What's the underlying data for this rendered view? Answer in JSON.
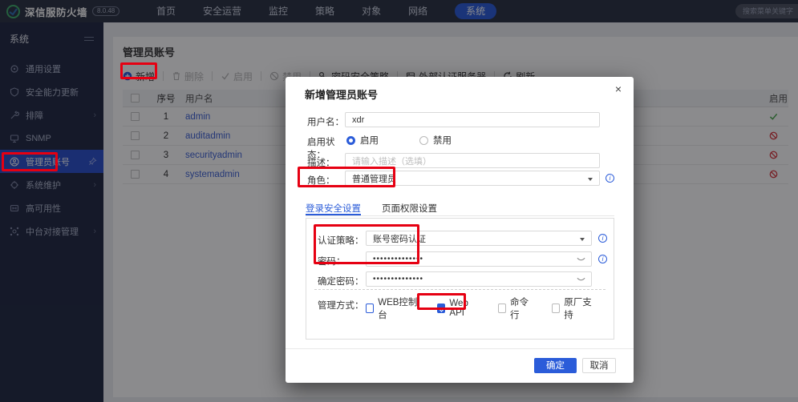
{
  "icons": {
    "chevron": "›",
    "info": "i",
    "hamburger": "",
    "close": "×"
  },
  "colors": {
    "accent": "#2b5cd9",
    "annotation": "#e60012",
    "enabled": "#49a84c",
    "disabled": "#d9363e",
    "topbar": "#2a3142",
    "sidebar": "#212942"
  },
  "topbar": {
    "brand": "深信服防火墙",
    "version": "8.0.48",
    "search_placeholder": "搜索菜单关键字",
    "nav_items": [
      {
        "label": "首页",
        "active": false
      },
      {
        "label": "安全运营",
        "active": false
      },
      {
        "label": "监控",
        "active": false
      },
      {
        "label": "策略",
        "active": false
      },
      {
        "label": "对象",
        "active": false
      },
      {
        "label": "网络",
        "active": false
      },
      {
        "label": "系统",
        "active": true
      }
    ]
  },
  "sidebar": {
    "title": "系统",
    "items": [
      {
        "label": "通用设置",
        "icon": "gear-icon",
        "has_children": false,
        "active": false
      },
      {
        "label": "安全能力更新",
        "icon": "shield-icon",
        "has_children": false,
        "active": false
      },
      {
        "label": "排障",
        "icon": "wrench-icon",
        "has_children": true,
        "active": false
      },
      {
        "label": "SNMP",
        "icon": "monitor-icon",
        "has_children": false,
        "active": false
      },
      {
        "label": "管理员账号",
        "icon": "admin-user-icon",
        "has_children": false,
        "active": true,
        "pinned": true
      },
      {
        "label": "系统维护",
        "icon": "maintenance-gear-icon",
        "has_children": true,
        "active": false
      },
      {
        "label": "高可用性",
        "icon": "ha-icon",
        "has_children": false,
        "active": false
      },
      {
        "label": "中台对接管理",
        "icon": "platform-icon",
        "has_children": true,
        "active": false
      }
    ]
  },
  "content": {
    "page_title": "管理员账号",
    "toolbar": {
      "add": "新增",
      "delete": "删除",
      "enable": "启用",
      "disable": "禁用",
      "password_policy": "密码安全策略",
      "external_auth": "外部认证服务器",
      "refresh": "刷新"
    },
    "table": {
      "headers": {
        "index": "序号",
        "username": "用户名",
        "enabled": "启用"
      },
      "rows": [
        {
          "index": "1",
          "username": "admin",
          "status": "enabled"
        },
        {
          "index": "2",
          "username": "auditadmin",
          "status": "disabled"
        },
        {
          "index": "3",
          "username": "securityadmin",
          "status": "disabled"
        },
        {
          "index": "4",
          "username": "systemadmin",
          "status": "disabled"
        }
      ]
    }
  },
  "modal": {
    "title": "新增管理员账号",
    "close": "×",
    "fields": {
      "username_label": "用户名：",
      "username_value": "xdr",
      "status_label": "启用状态：",
      "status_enable": "启用",
      "status_disable": "禁用",
      "desc_label": "描述：",
      "desc_placeholder": "请输入描述（选填）",
      "role_label": "角色：",
      "role_value": "普通管理员"
    },
    "tabs": {
      "login_security": "登录安全设置",
      "page_permission": "页面权限设置"
    },
    "security": {
      "auth_label": "认证策略：",
      "auth_value": "账号密码认证",
      "password_label": "密码：",
      "password_value": "••••••••••••••",
      "confirm_label": "确定密码：",
      "confirm_value": "••••••••••••••",
      "mgmt_label": "管理方式：",
      "mgmt_options": [
        {
          "label": "WEB控制台",
          "checked": false
        },
        {
          "label": "Web API",
          "checked": true
        },
        {
          "label": "命令行",
          "checked": false
        },
        {
          "label": "原厂支持",
          "checked": false
        }
      ]
    },
    "footer": {
      "ok": "确定",
      "cancel": "取消"
    }
  }
}
